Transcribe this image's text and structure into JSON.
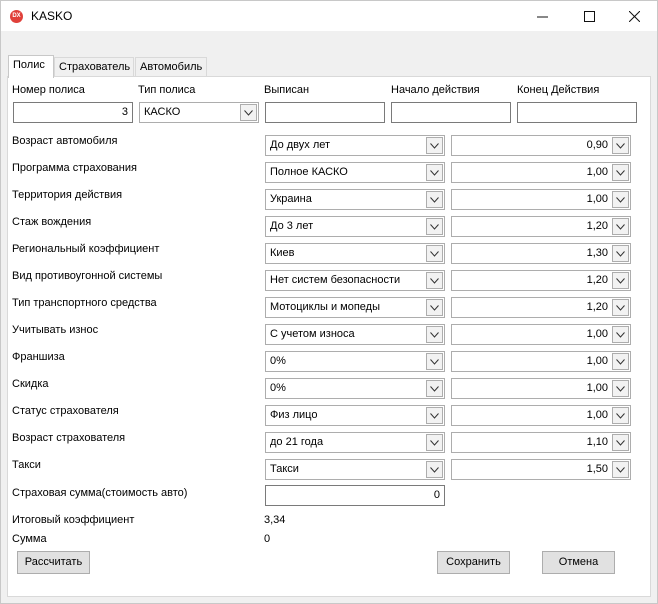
{
  "window": {
    "title": "KASKO",
    "icon_text": "DX"
  },
  "tabs": [
    {
      "label": "Полис"
    },
    {
      "label": "Страхователь"
    },
    {
      "label": "Автомобиль"
    }
  ],
  "header": {
    "policy_number_label": "Номер полиса",
    "policy_number_value": "3",
    "policy_type_label": "Тип полиса",
    "policy_type_value": "КАСКО",
    "issued_label": "Выписан",
    "issued_value": "",
    "start_label": "Начало действия",
    "start_value": "",
    "end_label": "Конец Действия",
    "end_value": ""
  },
  "rows": [
    {
      "label": "Возраст автомобиля",
      "option": "До двух лет",
      "coef": "0,90"
    },
    {
      "label": "Программа страхования",
      "option": "Полное КАСКО",
      "coef": "1,00"
    },
    {
      "label": "Территория действия",
      "option": "Украина",
      "coef": "1,00"
    },
    {
      "label": "Стаж вождения",
      "option": "До 3 лет",
      "coef": "1,20"
    },
    {
      "label": "Региональный коэффициент",
      "option": "Киев",
      "coef": "1,30"
    },
    {
      "label": "Вид противоугонной системы",
      "option": "Нет систем безопасности",
      "coef": "1,20"
    },
    {
      "label": "Тип транспортного средства",
      "option": "Мотоциклы и мопеды",
      "coef": "1,20"
    },
    {
      "label": "Учитывать износ",
      "option": "С учетом износа",
      "coef": "1,00"
    },
    {
      "label": "Франшиза",
      "option": "0%",
      "coef": "1,00"
    },
    {
      "label": "Скидка",
      "option": "0%",
      "coef": "1,00"
    },
    {
      "label": "Статус страхователя",
      "option": "Физ лицо",
      "coef": "1,00"
    },
    {
      "label": "Возраст страхователя",
      "option": "до 21 года",
      "coef": "1,10"
    },
    {
      "label": "Такси",
      "option": "Такси",
      "coef": "1,50"
    }
  ],
  "sum_insured": {
    "label": "Страховая сумма(стоимость авто)",
    "value": "0"
  },
  "total_coef": {
    "label": "Итоговый коэффициент",
    "value": "3,34"
  },
  "total_sum": {
    "label": "Сумма",
    "value": "0"
  },
  "buttons": {
    "calculate": "Рассчитать",
    "save": "Сохранить",
    "cancel": "Отмена"
  }
}
